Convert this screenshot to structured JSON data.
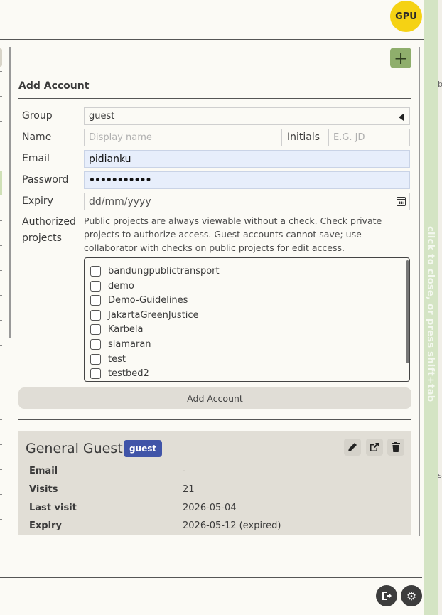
{
  "header": {
    "badge": "GPU"
  },
  "form": {
    "title": "Add Account",
    "group": {
      "label": "Group",
      "value": "guest"
    },
    "name": {
      "label": "Name",
      "placeholder": "Display name"
    },
    "initials": {
      "label": "Initials",
      "placeholder": "E.G. JD"
    },
    "email": {
      "label": "Email",
      "value": "pidianku"
    },
    "password": {
      "label": "Password",
      "value": "•••••••••••"
    },
    "expiry": {
      "label": "Expiry",
      "placeholder": "dd/mm/yyyy"
    },
    "authorized": {
      "label_line1": "Authorized",
      "label_line2": "projects",
      "help": "Public projects are always viewable without a check. Check private projects to authorize access. Guest accounts cannot save; use collaborator with checks on public projects for edit access.",
      "projects": [
        "bandungpublictransport",
        "demo",
        "Demo-Guidelines",
        "JakartaGreenJustice",
        "Karbela",
        "slamaran",
        "test",
        "testbed2"
      ]
    },
    "submit_label": "Add Account"
  },
  "account_card": {
    "name": "General Guest",
    "tag": "guest",
    "rows": [
      {
        "key": "Email",
        "value": "-"
      },
      {
        "key": "Visits",
        "value": "21"
      },
      {
        "key": "Last visit",
        "value": "2026-05-04"
      },
      {
        "key": "Expiry",
        "value": "2026-05-12 (expired)"
      }
    ]
  },
  "side_panel": {
    "hint": "click to close, or press shift+tab"
  },
  "edge_marks": [
    "b",
    "s"
  ],
  "colors": {
    "add_button": "#8fae6c",
    "badge": "#f5d214",
    "tag": "#4054a8",
    "side_strip": "#d4e4c4"
  }
}
